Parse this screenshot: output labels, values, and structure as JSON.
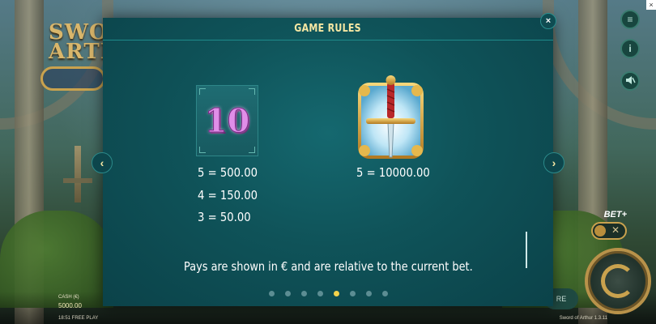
{
  "modal": {
    "title": "GAME RULES",
    "close_glyph": "×",
    "prev_glyph": "‹",
    "next_glyph": "›",
    "footnote": "Pays are shown in € and are relative to the current bet.",
    "pages_total": 8,
    "active_page": 5
  },
  "symbols": [
    {
      "name": "ten",
      "glyph": "10",
      "payouts": [
        "5 = 500.00",
        "4 = 150.00",
        "3 = 50.00"
      ]
    },
    {
      "name": "sword",
      "payouts": [
        "5 = 10000.00"
      ]
    }
  ],
  "background": {
    "logo_line1": "SWOR",
    "logo_line2": "ARTH",
    "cash_label": "CASH (€)",
    "cash_value": "5000.00",
    "time": "18:51 FREE PLAY",
    "version": "Sword of Arthur 1.3.11",
    "bet_plus_label": "BET+",
    "toggle_off": "✕",
    "auto_label": "RE",
    "corner_close": "×"
  },
  "side_buttons": [
    {
      "icon": "menu-icon",
      "glyph": "≡"
    },
    {
      "icon": "info-icon",
      "glyph": "i"
    },
    {
      "icon": "sound-off-icon",
      "glyph": "🔇"
    }
  ],
  "colors": {
    "title": "#f6e7a3",
    "active_dot": "#f3d24a",
    "inactive_dot": "#5c8d93",
    "panel": "#0f5359"
  }
}
